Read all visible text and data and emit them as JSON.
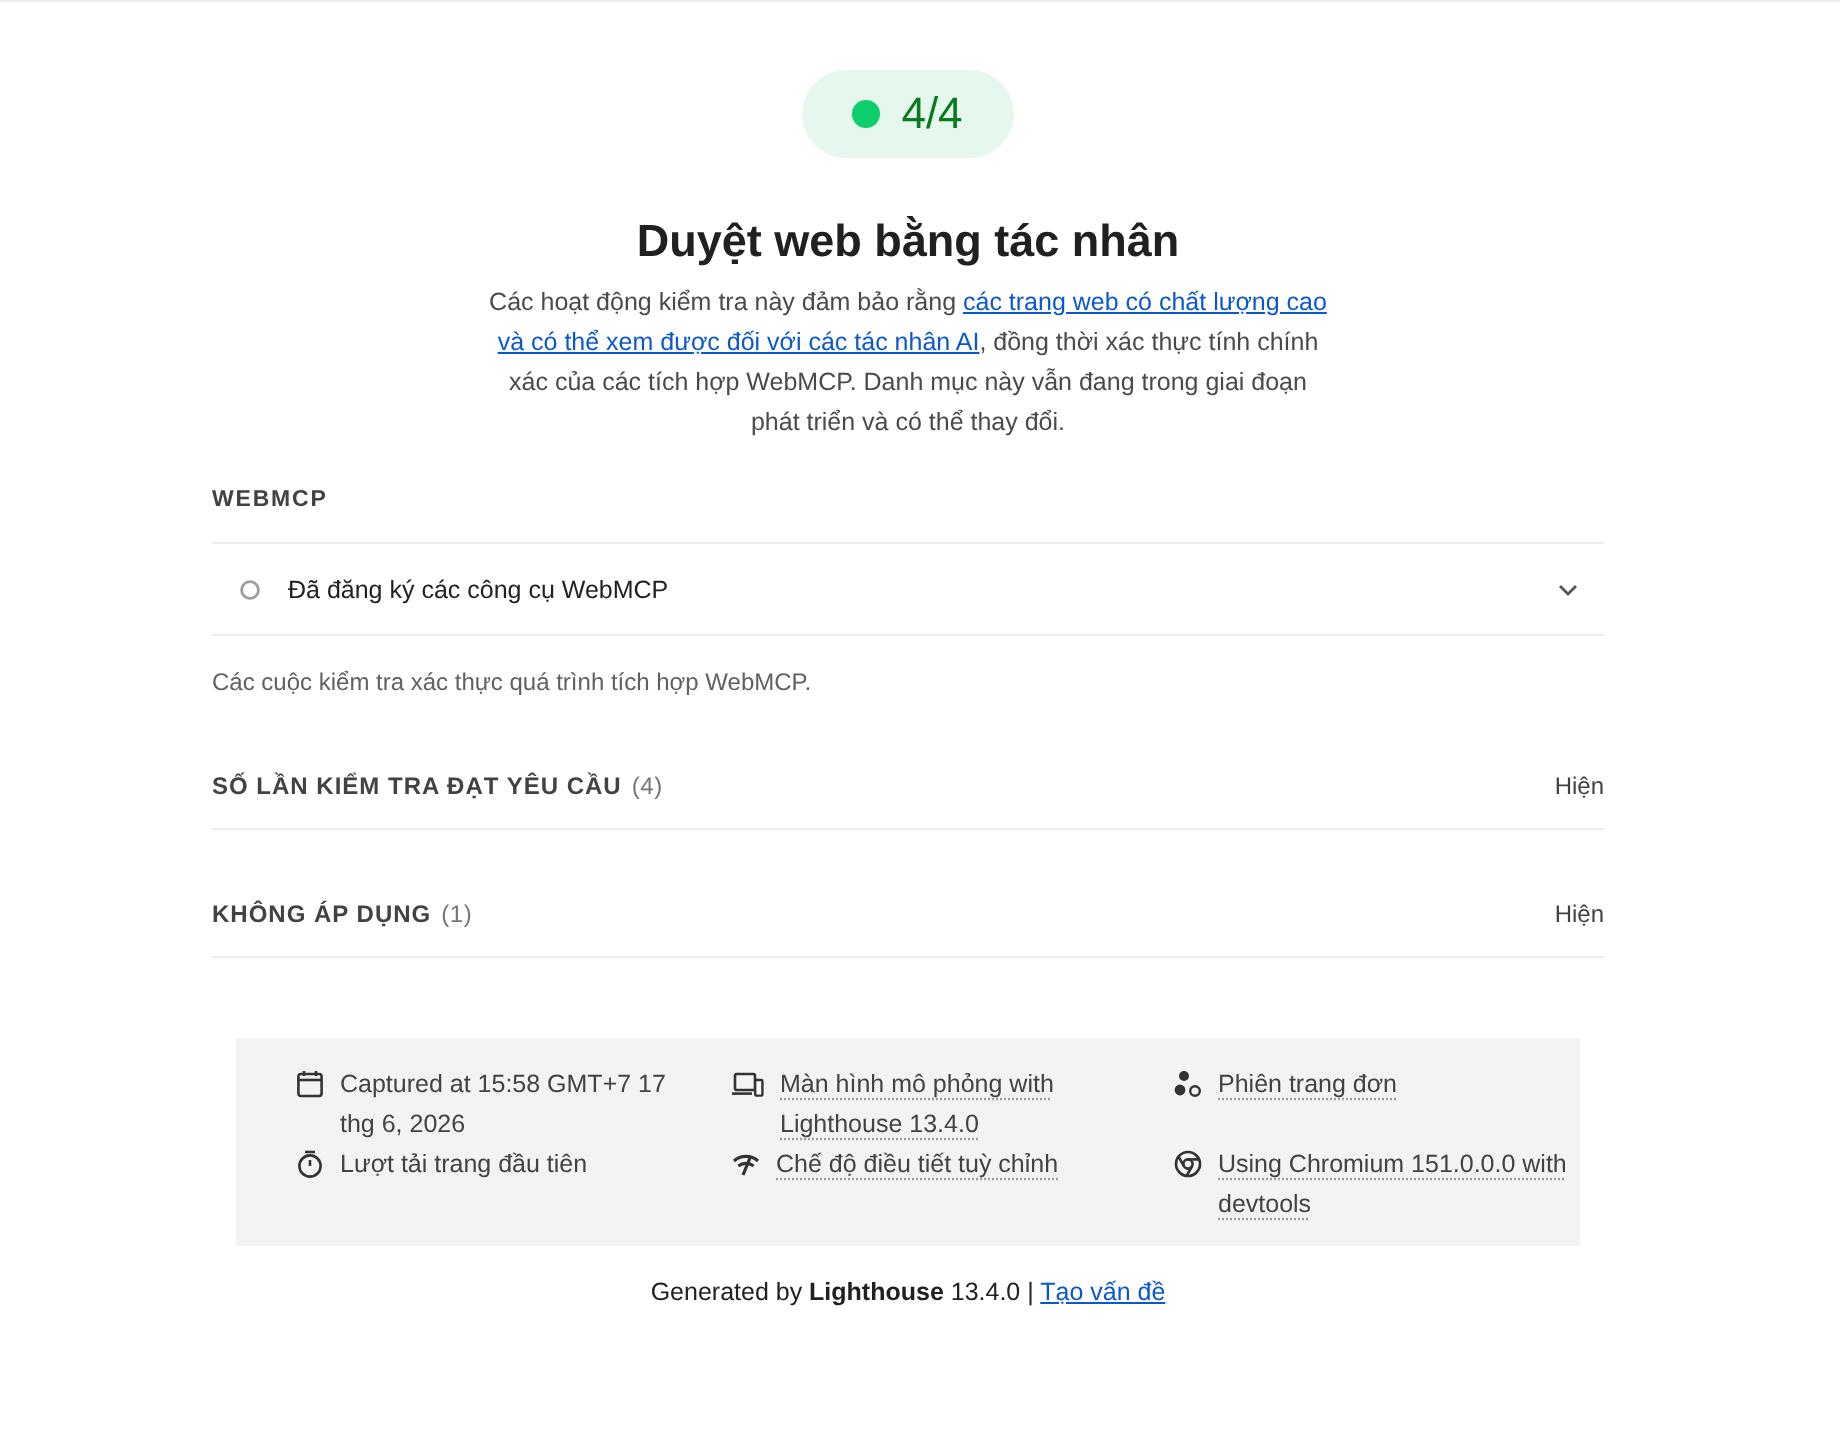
{
  "score_badge": {
    "value": "4/4",
    "kind": "pass"
  },
  "category": {
    "title": "Duyệt web bằng tác nhân",
    "description": [
      {
        "kind": "text",
        "text": "Các hoạt động kiểm tra này đảm bảo rằng "
      },
      {
        "kind": "link",
        "text": "các trang web có chất lượng cao"
      },
      {
        "kind": "link",
        "text": "và có thể xem được đối với các tác nhân AI"
      },
      {
        "kind": "text",
        "text": ", đồng thời xác thực tính chính xác của các tích hợp WebMCP. Danh mục này vẫn đang trong giai đoạn phát triển và có thể thay đổi."
      }
    ]
  },
  "groups": [
    {
      "title": "WEBMCP",
      "audits": [
        {
          "title": "Đã đăng ký các công cụ WebMCP",
          "kind": "informative",
          "expanded": false
        }
      ],
      "description": "Các cuộc kiểm tra xác thực quá trình tích hợp WebMCP."
    }
  ],
  "clumps": [
    {
      "title": "SỐ LẦN KIỂM TRA ĐẠT YÊU CẦU",
      "count": "(4)",
      "toggle": "Hiện"
    },
    {
      "title": "KHÔNG ÁP DỤNG",
      "count": "(1)",
      "toggle": "Hiện"
    }
  ],
  "runtime_settings": [
    {
      "kind": "date",
      "text": "Captured at 15:58 GMT+7 17 thg 6, 2026",
      "tooltip": false
    },
    {
      "kind": "devices",
      "text": "Màn hình mô phỏng with Lighthouse 13.4.0",
      "tooltip": true
    },
    {
      "kind": "session",
      "text": "Phiên trang đơn",
      "tooltip": true
    },
    {
      "kind": "timer",
      "text": "Lượt tải trang đầu tiên",
      "tooltip": false
    },
    {
      "kind": "throttling",
      "text": "Chế độ điều tiết tuỳ chỉnh",
      "tooltip": true
    },
    {
      "kind": "browser",
      "text": "Using Chromium 151.0.0.0 with devtools",
      "tooltip": true
    }
  ],
  "footer": {
    "text": "Generated by **Lighthouse** 13.4.0 |",
    "link": "Tạo vấn đề"
  }
}
